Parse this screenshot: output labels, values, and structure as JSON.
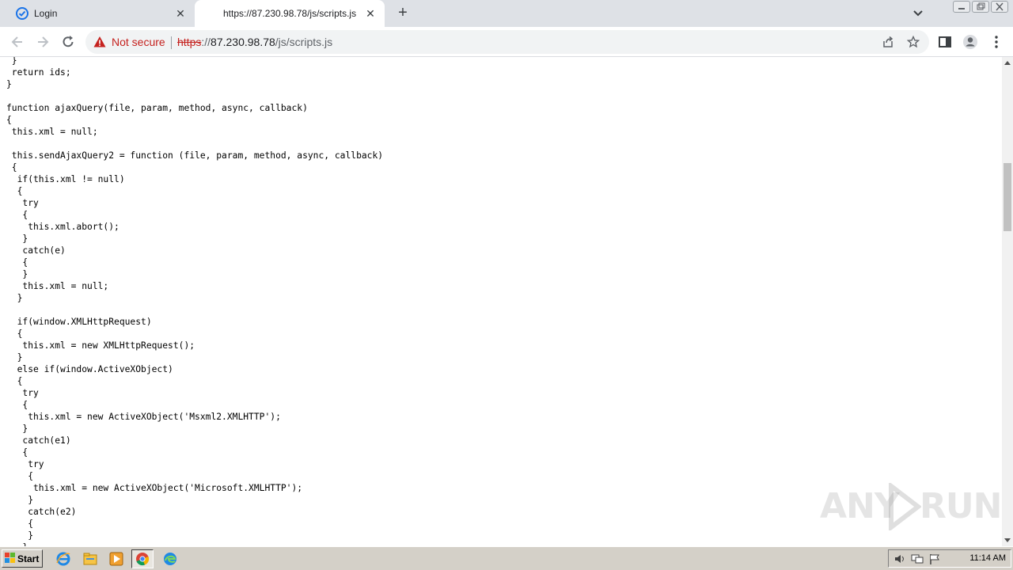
{
  "browser": {
    "tabs": [
      {
        "title": "Login",
        "active": false
      },
      {
        "title": "https://87.230.98.78/js/scripts.js",
        "active": true
      }
    ],
    "new_tab_label": "+",
    "close_glyph": "✕"
  },
  "address_bar": {
    "security_label": "Not secure",
    "url_scheme": "https",
    "url_rest_prefix": "://",
    "url_host": "87.230.98.78",
    "url_path": "/js/scripts.js"
  },
  "page": {
    "code_lines": [
      " }",
      " return ids;",
      "}",
      "",
      "function ajaxQuery(file, param, method, async, callback)",
      "{",
      " this.xml = null;",
      "",
      " this.sendAjaxQuery2 = function (file, param, method, async, callback)",
      " {",
      "  if(this.xml != null)",
      "  {",
      "   try",
      "   {",
      "    this.xml.abort();",
      "   }",
      "   catch(e)",
      "   {",
      "   }",
      "   this.xml = null;",
      "  }",
      "",
      "  if(window.XMLHttpRequest)",
      "  {",
      "   this.xml = new XMLHttpRequest();",
      "  }",
      "  else if(window.ActiveXObject)",
      "  {",
      "   try",
      "   {",
      "    this.xml = new ActiveXObject('Msxml2.XMLHTTP');",
      "   }",
      "   catch(e1)",
      "   {",
      "    try",
      "    {",
      "     this.xml = new ActiveXObject('Microsoft.XMLHTTP');",
      "    }",
      "    catch(e2)",
      "    {",
      "    }",
      "   }"
    ]
  },
  "watermark": {
    "left": "ANY",
    "right": "RUN"
  },
  "taskbar": {
    "start_label": "Start",
    "clock": "11:14 AM",
    "apps": [
      "internet-explorer-icon",
      "file-explorer-icon",
      "media-player-icon",
      "chrome-icon",
      "edge-icon"
    ]
  },
  "colors": {
    "not_secure": "#c5221f",
    "tab_strip": "#dee1e6",
    "taskbar": "#d4d0c8"
  }
}
